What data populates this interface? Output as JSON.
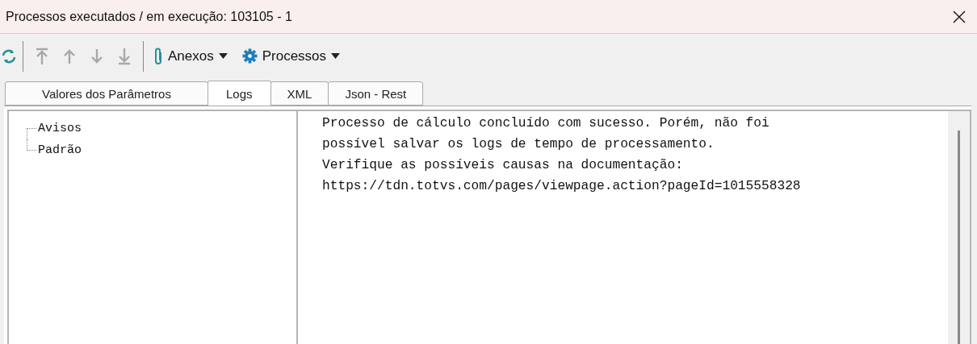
{
  "window": {
    "title": "Processos executados / em execução: 103105 - 1"
  },
  "toolbar": {
    "nav_buttons": [
      {
        "kind": "refresh",
        "disabled": false
      },
      {
        "kind": "top",
        "disabled": true
      },
      {
        "kind": "up",
        "disabled": true
      },
      {
        "kind": "down",
        "disabled": true
      },
      {
        "kind": "bottom",
        "disabled": true
      }
    ],
    "menus": [
      {
        "kind": "attach",
        "label": "Anexos"
      },
      {
        "kind": "gear",
        "label": "Processos"
      }
    ]
  },
  "tabs": [
    {
      "label": "Valores dos Parâmetros",
      "selected": false
    },
    {
      "label": "Logs",
      "selected": true
    },
    {
      "label": "XML",
      "selected": false
    },
    {
      "label": "Json - Rest",
      "selected": false
    }
  ],
  "tree": {
    "items": [
      {
        "label": "Avisos"
      },
      {
        "label": "Padrão"
      }
    ]
  },
  "log": {
    "lines": [
      "Processo de cálculo concluído com sucesso. Porém, não foi",
      "possível salvar os logs de tempo de processamento.",
      "Verifique as possíveis causas na documentação:",
      "https://tdn.totvs.com/pages/viewpage.action?pageId=1015558328"
    ]
  }
}
